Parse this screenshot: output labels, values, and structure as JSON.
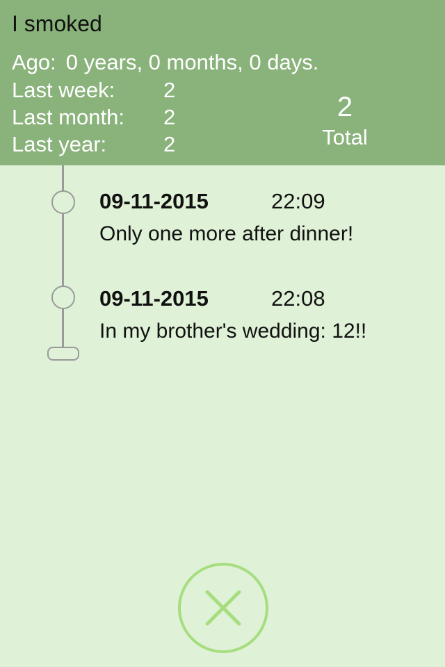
{
  "header": {
    "title": "I smoked",
    "ago_label": "Ago:",
    "ago_value": "0 years, 0 months, 0 days.",
    "stats": [
      {
        "label": "Last week:",
        "value": "2"
      },
      {
        "label": "Last month:",
        "value": "2"
      },
      {
        "label": "Last year:",
        "value": "2"
      }
    ],
    "total_count": "2",
    "total_label": "Total"
  },
  "entries": [
    {
      "date": "09-11-2015",
      "time": "22:09",
      "note": "Only one more after dinner!"
    },
    {
      "date": "09-11-2015",
      "time": "22:08",
      "note": "In my brother's wedding: 12!!"
    }
  ],
  "close_button": {
    "icon": "close-icon"
  },
  "colors": {
    "header_bg": "#8ab27b",
    "page_bg": "#dff1d6",
    "timeline": "#9a9a9a",
    "close_accent": "#a6de7f"
  }
}
